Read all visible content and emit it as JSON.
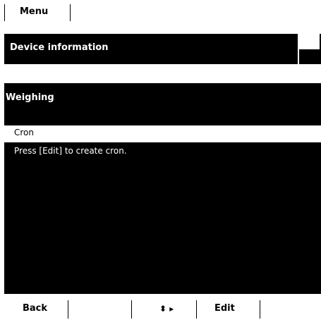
{
  "menu": {
    "label": "Menu"
  },
  "device_info": {
    "title": "Device information"
  },
  "weighing": {
    "title": "Weighing",
    "selected_item": "Cron",
    "message": "Press [Edit] to create cron."
  },
  "softkeys": {
    "back": "Back",
    "navigate": "⬍ ▸",
    "edit": "Edit"
  }
}
